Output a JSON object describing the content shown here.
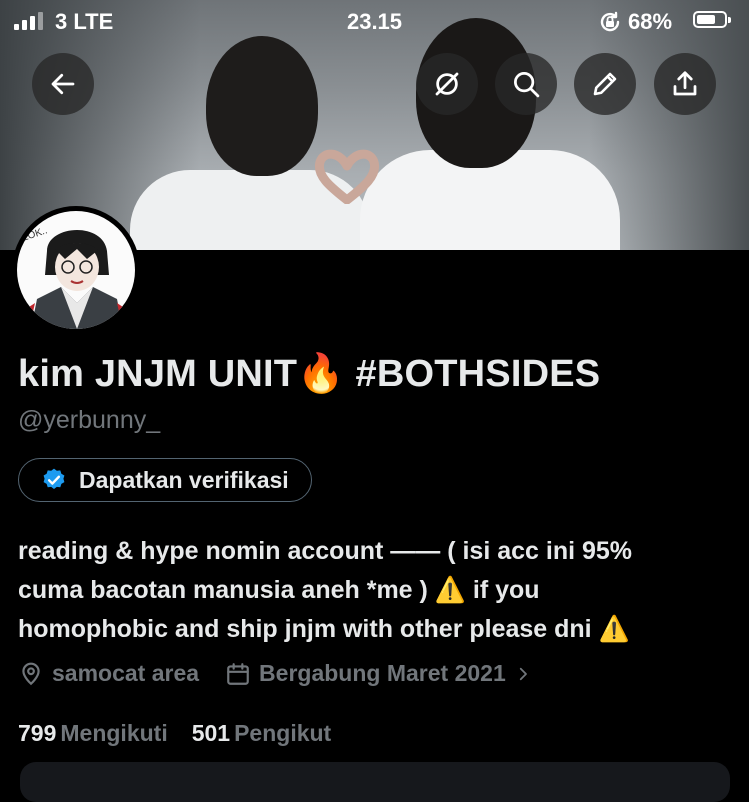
{
  "status_bar": {
    "carrier": "3  LTE",
    "time": "23.15",
    "battery_percent": "68%",
    "battery_level": 0.68
  },
  "header_buttons": {
    "back": "back-arrow-icon",
    "grok": "grok-icon",
    "search": "search-icon",
    "edit": "edit-icon",
    "share": "share-icon"
  },
  "profile": {
    "display_name": "kim JNJM UNIT🔥 #BOTHSIDES",
    "handle": "@yerbunny_",
    "verify_button": "Dapatkan verifikasi",
    "bio": "reading & hype nomin account —— ( isi acc ini 95%\ncuma bacotan manusia aneh *me ) ⚠️ if you\nhomophobic and ship jnjm with other please dni ⚠️",
    "location": "samocat area",
    "joined": "Bergabung Maret 2021",
    "following_count": "799",
    "following_label": "Mengikuti",
    "followers_count": "501",
    "followers_label": "Pengikut"
  },
  "colors": {
    "background": "#000000",
    "text_primary": "#e7e9ea",
    "text_secondary": "#71767b",
    "verify_badge": "#1d9bf0"
  }
}
